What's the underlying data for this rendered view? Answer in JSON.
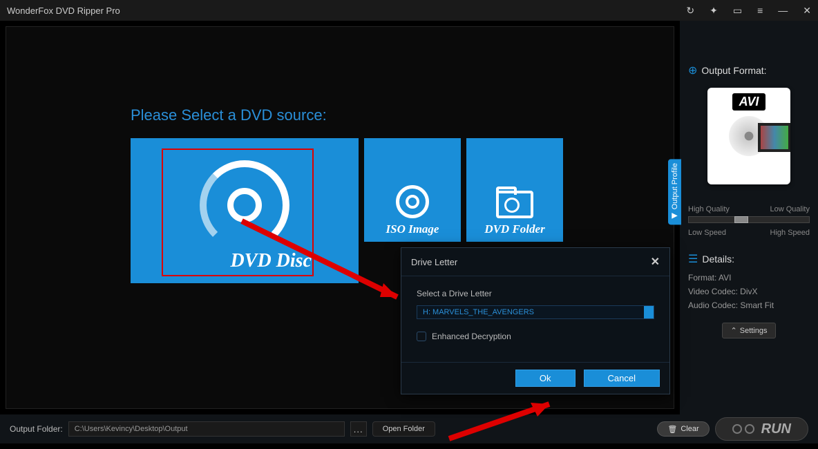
{
  "titlebar": {
    "title": "WonderFox DVD Ripper Pro"
  },
  "main": {
    "prompt": "Please Select a DVD source:",
    "tiles": {
      "dvd_disc": "DVD Disc",
      "iso_image": "ISO Image",
      "dvd_folder": "DVD Folder"
    },
    "output_profile_tab": "Output Profile"
  },
  "sidebar": {
    "output_format_label": "Output Format:",
    "format_badge": "AVI",
    "quality": {
      "high": "High Quality",
      "low": "Low Quality"
    },
    "speed": {
      "low": "Low Speed",
      "high": "High Speed"
    },
    "details_label": "Details:",
    "details": {
      "format": "Format: AVI",
      "video_codec": "Video Codec: DivX",
      "audio_codec": "Audio Codec: Smart Fit"
    },
    "settings": "Settings"
  },
  "footer": {
    "label": "Output Folder:",
    "path": "C:\\Users\\Kevincy\\Desktop\\Output",
    "browse": "...",
    "open": "Open Folder",
    "clear": "Clear",
    "run": "RUN"
  },
  "dialog": {
    "title": "Drive Letter",
    "select_label": "Select a Drive Letter",
    "drive_value": "H:   MARVELS_THE_AVENGERS",
    "enhanced": "Enhanced Decryption",
    "ok": "Ok",
    "cancel": "Cancel"
  }
}
